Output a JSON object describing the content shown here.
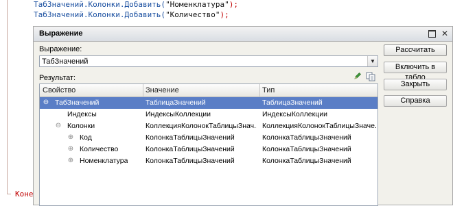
{
  "code": {
    "line1": {
      "prefix": "ТабЗначений.Колонки.Добавить(",
      "arg": "\"Номенклатура\"",
      "suffix": ");"
    },
    "line2": {
      "prefix": "ТабЗначений.Колонки.Добавить(",
      "arg": "\"Количество\"",
      "suffix": ");"
    },
    "tail": "Коне"
  },
  "dialog": {
    "title": "Выражение",
    "expression_label": "Выражение:",
    "expression_value": "ТабЗначений",
    "result_label": "Результат:",
    "columns": [
      "Свойство",
      "Значение",
      "Тип"
    ],
    "rows": [
      {
        "expander": "⊖",
        "property": "ТабЗначений",
        "value": "ТаблицаЗначений",
        "type": "ТаблицаЗначений",
        "selected": true
      },
      {
        "expander": "",
        "property": "Индексы",
        "value": "ИндексыКоллекции",
        "type": "ИндексыКоллекции",
        "selected": false
      },
      {
        "expander": "⊖",
        "property": "Колонки",
        "value": "КоллекцияКолонокТаблицыЗнач...",
        "type": "КоллекцияКолонокТаблицыЗначе...",
        "selected": false
      },
      {
        "expander": "⊕",
        "property": "Код",
        "value": "КолонкаТаблицыЗначений",
        "type": "КолонкаТаблицыЗначений",
        "selected": false
      },
      {
        "expander": "⊕",
        "property": "Количество",
        "value": "КолонкаТаблицыЗначений",
        "type": "КолонкаТаблицыЗначений",
        "selected": false
      },
      {
        "expander": "⊕",
        "property": "Номенклатура",
        "value": "КолонкаТаблицыЗначений",
        "type": "КолонкаТаблицыЗначений",
        "selected": false
      }
    ],
    "buttons": {
      "calculate": "Рассчитать",
      "to_table": "Включить в табло",
      "close": "Закрыть",
      "help": "Справка"
    }
  },
  "colors": {
    "selection": "#5a7ec6",
    "code_keyword": "#1a4fa0",
    "code_red": "#c00000"
  }
}
